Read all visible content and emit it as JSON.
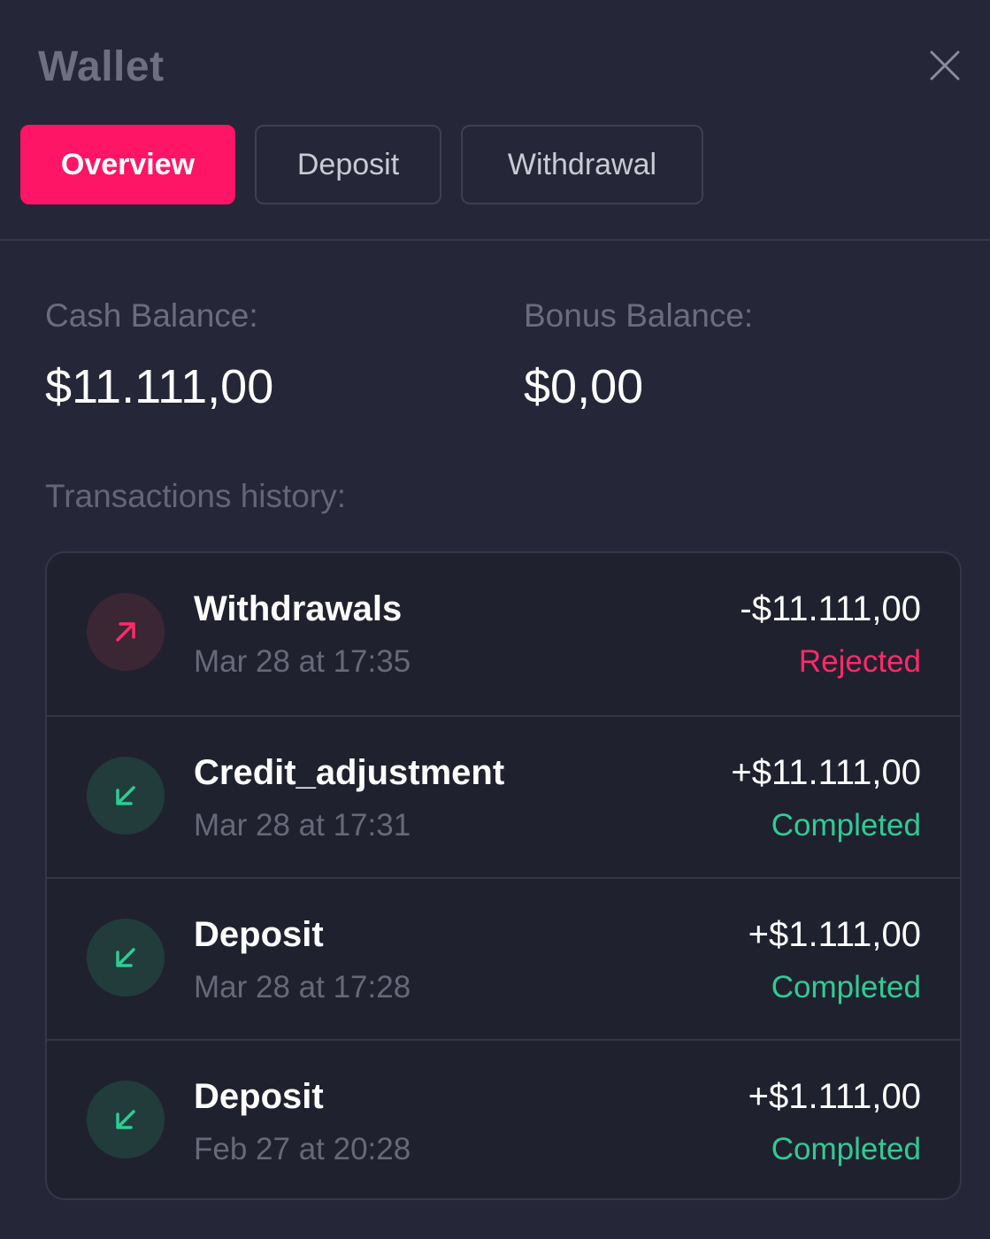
{
  "header": {
    "title": "Wallet",
    "close_icon": "close-icon"
  },
  "tabs": [
    {
      "label": "Overview",
      "active": true
    },
    {
      "label": "Deposit",
      "active": false
    },
    {
      "label": "Withdrawal",
      "active": false
    }
  ],
  "balances": {
    "cash_label": "Cash Balance:",
    "cash_value": "$11.111,00",
    "bonus_label": "Bonus Balance:",
    "bonus_value": "$0,00"
  },
  "transactions": {
    "label": "Transactions history:",
    "items": [
      {
        "name": "Withdrawals",
        "date": "Mar 28 at 17:35",
        "amount": "-$11.111,00",
        "status": "Rejected",
        "direction": "out",
        "icon": "arrow-up-right-icon"
      },
      {
        "name": "Credit_adjustment",
        "date": "Mar 28 at 17:31",
        "amount": "+$11.111,00",
        "status": "Completed",
        "direction": "in",
        "icon": "arrow-down-left-icon"
      },
      {
        "name": "Deposit",
        "date": "Mar 28 at 17:28",
        "amount": "+$1.111,00",
        "status": "Completed",
        "direction": "in",
        "icon": "arrow-down-left-icon"
      },
      {
        "name": "Deposit",
        "date": "Feb 27 at 20:28",
        "amount": "+$1.111,00",
        "status": "Completed",
        "direction": "in",
        "icon": "arrow-down-left-icon"
      }
    ]
  },
  "colors": {
    "background": "#252637",
    "accent": "#ff1565",
    "rejected": "#ff2a6a",
    "completed": "#2ecc93"
  }
}
